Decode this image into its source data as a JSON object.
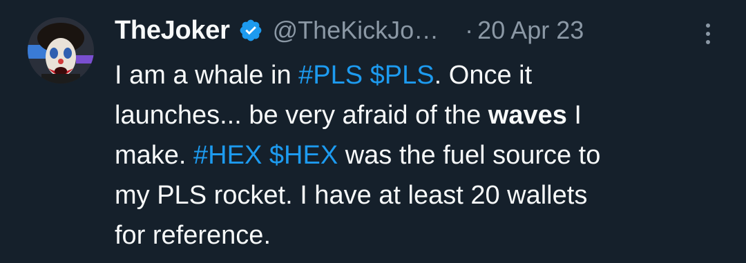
{
  "author": {
    "display_name": "TheJoker",
    "handle": "@TheKickJo…",
    "separator": "·",
    "date": "20 Apr 23",
    "verified_badge_color": "#1d9bf0"
  },
  "icons": {
    "verified": "verified-badge-icon",
    "more": "more-options-icon",
    "avatar": "avatar-image"
  },
  "tweet": {
    "line1": {
      "t1": "I am a whale in ",
      "hashtag": "#PLS",
      "space": " ",
      "cashtag": "$PLS",
      "t2": ". Once it"
    },
    "line2": {
      "t1": "launches... be very afraid of the ",
      "bold": "waves",
      "t2": " I"
    },
    "line3": {
      "t1": "make. ",
      "hashtag": "#HEX",
      "space": " ",
      "cashtag": "$HEX",
      "t2": " was the fuel source to"
    },
    "line4": "my PLS rocket. I have at least 20 wallets",
    "line5": "for reference."
  },
  "colors": {
    "background": "#15202b",
    "text": "#f7f9f9",
    "secondary": "#8b98a5",
    "link": "#1d9bf0"
  }
}
